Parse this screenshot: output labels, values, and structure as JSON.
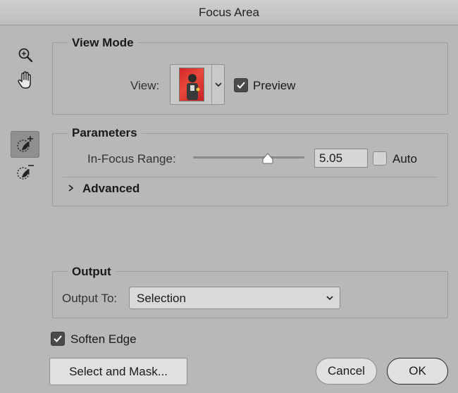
{
  "window": {
    "title": "Focus Area"
  },
  "tools": [
    {
      "name": "zoom-icon"
    },
    {
      "name": "hand-icon"
    },
    {
      "name": "focus-area-add-icon",
      "selected": true
    },
    {
      "name": "focus-area-subtract-icon"
    }
  ],
  "view_mode": {
    "title": "View Mode",
    "view_label": "View:",
    "preview_label": "Preview",
    "preview_checked": true
  },
  "parameters": {
    "title": "Parameters",
    "range_label": "In-Focus Range:",
    "range_value": "5.05",
    "slider_fraction": 0.67,
    "auto_label": "Auto",
    "auto_checked": false,
    "advanced_label": "Advanced"
  },
  "output": {
    "title": "Output",
    "output_to_label": "Output To:",
    "selected_option": "Selection"
  },
  "soften_edge": {
    "label": "Soften Edge",
    "checked": true
  },
  "buttons": {
    "select_and_mask": "Select and Mask...",
    "cancel": "Cancel",
    "ok": "OK"
  },
  "colors": {
    "background": "#b8b8b8",
    "checkbox_checked": "#4a4a4a",
    "thumbnail_red": "#d5252a"
  }
}
